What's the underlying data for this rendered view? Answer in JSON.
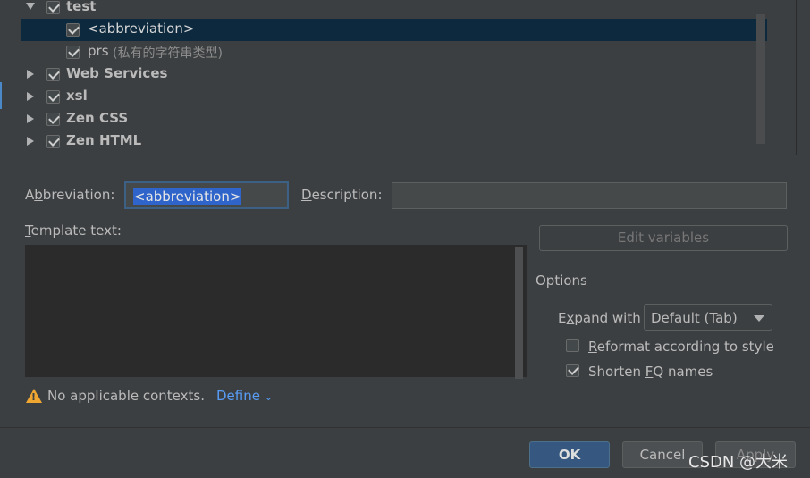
{
  "tree": {
    "items": [
      {
        "label": "test",
        "bold": true,
        "checked": true,
        "expanded": true
      },
      {
        "label": "<abbreviation>",
        "bold": false,
        "checked": true,
        "selected": true
      },
      {
        "label": "prs",
        "hint": "(私有的字符串类型)",
        "bold": false,
        "checked": true
      },
      {
        "label": "Web Services",
        "bold": true,
        "checked": true,
        "expanded": false
      },
      {
        "label": "xsl",
        "bold": true,
        "checked": true,
        "expanded": false
      },
      {
        "label": "Zen CSS",
        "bold": true,
        "checked": true,
        "expanded": false
      },
      {
        "label": "Zen HTML",
        "bold": true,
        "checked": true,
        "expanded": false
      }
    ]
  },
  "form": {
    "abbreviation_label_pre": "A",
    "abbreviation_label_u": "b",
    "abbreviation_label_post": "breviation:",
    "abbreviation_value": "<abbreviation>",
    "description_label_u": "D",
    "description_label_post": "escription:",
    "description_value": "",
    "template_label_u": "T",
    "template_label_post": "emplate text:",
    "template_value": ""
  },
  "options": {
    "edit_variables": "Edit variables",
    "title": "Options",
    "expand_label_pre": "E",
    "expand_label_u": "x",
    "expand_label_post": "pand with",
    "expand_value": "Default (Tab)",
    "reformat_label_u": "R",
    "reformat_label_post": "eformat according to style",
    "reformat_checked": false,
    "shorten_label_pre": "Shorten ",
    "shorten_label_u": "F",
    "shorten_label_post": "Q names",
    "shorten_checked": true
  },
  "context": {
    "warning": "No applicable contexts.",
    "define": "Define"
  },
  "buttons": {
    "ok": "OK",
    "cancel": "Cancel",
    "apply": "Apply"
  },
  "watermark": "CSDN @大米"
}
